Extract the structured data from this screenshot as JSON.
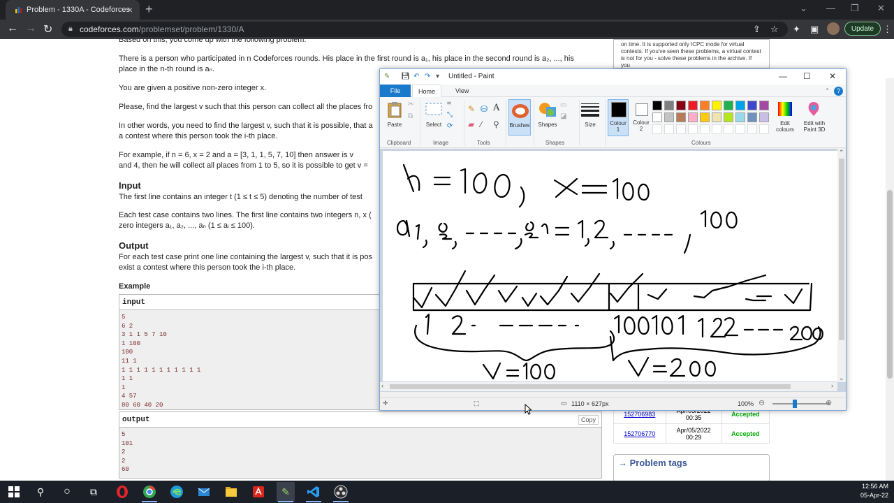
{
  "browser": {
    "tab_title": "Problem - 1330A - Codeforces",
    "url_domain": "codeforces.com",
    "url_path": "/problemset/problem/1330/A",
    "update_label": "Update"
  },
  "problem": {
    "intro_cut": "Based on this, you come up with the following problem:",
    "p1": "There is a person who participated in n Codeforces rounds. His place in the first round is a₁, his place in the second round is a₂, ..., his",
    "p1b": "place in the n-th round is aₙ.",
    "p2": "You are given a positive non-zero integer x.",
    "p3": "Please, find the largest v such that this person can collect all the places fro",
    "p4": "In other words, you need to find the largest v, such that it is possible, that a",
    "p4b": "a contest where this person took the i-th place.",
    "p5": "For example, if n = 6, x = 2 and a = [3, 1, 1, 5, 7, 10] then answer is v",
    "p5b": "and 4, then he will collect all places from 1 to 5, so it is possible to get v =",
    "input_heading": "Input",
    "input_p1": "The first line contains an integer t (1 ≤ t ≤ 5) denoting the number of test",
    "input_p2": "Each test case contains two lines. The first line contains two integers n, x (",
    "input_p2b": "zero integers a₁, a₂, ..., aₙ (1 ≤ aᵢ ≤ 100).",
    "output_heading": "Output",
    "output_p1": "For each test case print one line containing the largest v, such that it is pos",
    "output_p1b": "exist a contest where this person took the i-th place.",
    "example_label": "Example",
    "input_label": "input",
    "input_data": "5\n6 2\n3 1 1 5 7 10\n1 100\n100\n11 1\n1 1 1 1 1 1 1 1 1 1 1\n1 1\n1\n4 57\n80 60 40 20",
    "output_label": "output",
    "output_data": "5\n101\n2\n2\n60",
    "copy_label": "Copy"
  },
  "sidebar": {
    "info_text": "on time. It is supported only ICPC mode for virtual contests. If you've seen these problems, a virtual contest is not for you - solve these problems in the archive. If you",
    "submissions": [
      {
        "id": "152706983",
        "date": "Apr/05/2022\n00:35",
        "verdict": "Accepted"
      },
      {
        "id": "152706770",
        "date": "Apr/05/2022\n00:29",
        "verdict": "Accepted"
      }
    ],
    "tags_title": "→ Problem tags"
  },
  "paint": {
    "title": "Untitled - Paint",
    "tabs": [
      "File",
      "Home",
      "View"
    ],
    "tools": {
      "paste": "Paste",
      "select": "Select",
      "brushes": "Brushes",
      "shapes": "Shapes",
      "size": "Size",
      "colour1": "Colour\n1",
      "colour2": "Colour\n2",
      "edit_colours": "Edit\ncolours",
      "edit_paint3d": "Edit with\nPaint 3D"
    },
    "groups": [
      "Clipboard",
      "Image",
      "Tools",
      "Shapes",
      "Colours"
    ],
    "palette": [
      "#000000",
      "#7f7f7f",
      "#880015",
      "#ed1c24",
      "#ff7f27",
      "#fff200",
      "#22b14c",
      "#00a2e8",
      "#3f48cc",
      "#a349a4",
      "#ffffff",
      "#c3c3c3",
      "#b97a57",
      "#ffaec9",
      "#ffc90e",
      "#efe4b0",
      "#b5e61d",
      "#99d9ea",
      "#7092be",
      "#c8bfe7"
    ],
    "status_size": "1110 × 627px",
    "zoom": "100%"
  },
  "taskbar": {
    "time": "12:56 AM",
    "date": "05-Apr-22"
  }
}
